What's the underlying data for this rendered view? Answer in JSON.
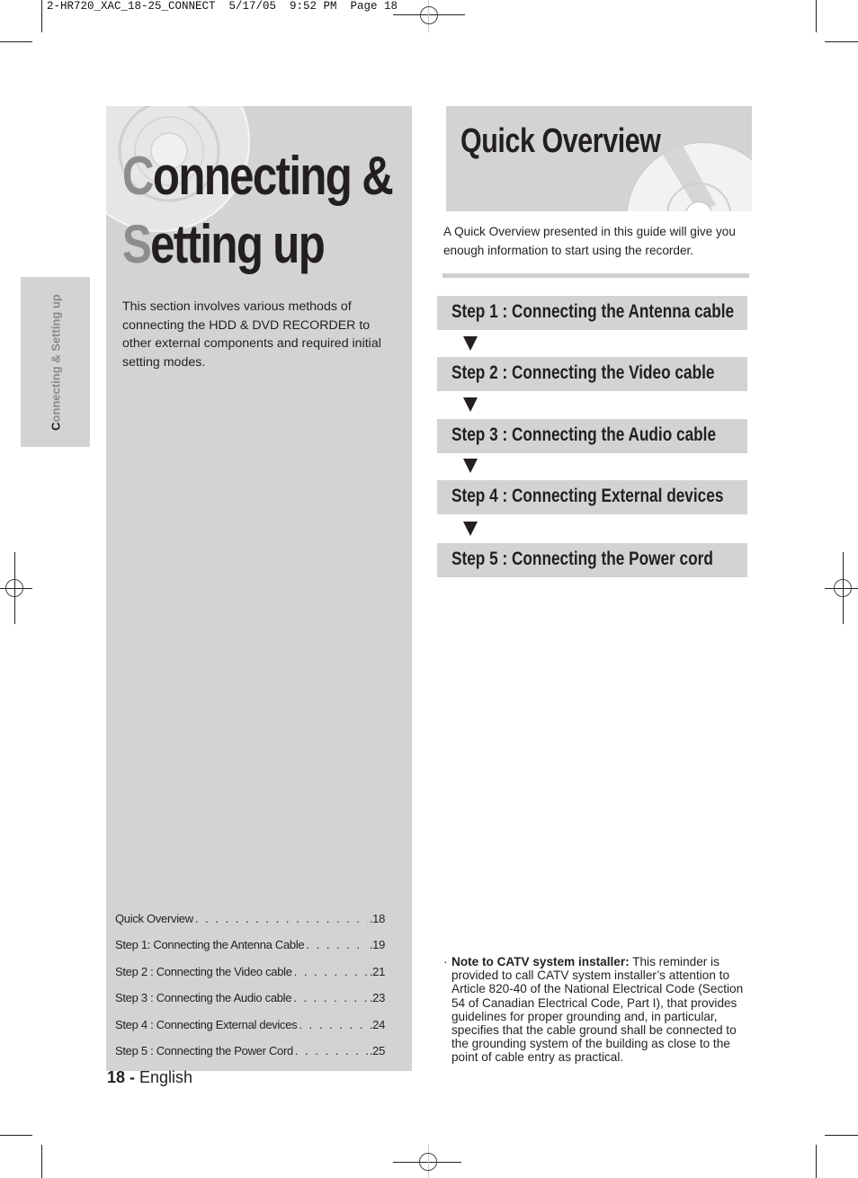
{
  "print_slug": "2-HR720_XAC_18-25_CONNECT  5/17/05  9:52 PM  Page 18",
  "side_tab": {
    "cap": "C",
    "rest": "onnecting & Setting up"
  },
  "chapter": {
    "title_line1_cap": "C",
    "title_line1_rest": "onnecting &",
    "title_line2_cap": "S",
    "title_line2_rest": "etting up",
    "intro": "This section involves various methods of connecting the HDD & DVD RECORDER to other external components and required initial setting modes."
  },
  "toc": [
    {
      "label": "Quick Overview",
      "page": ".18"
    },
    {
      "label": "Step 1: Connecting the Antenna Cable",
      "page": ".19"
    },
    {
      "label": "Step 2 : Connecting the Video cable",
      "page": ".21"
    },
    {
      "label": "Step 3 : Connecting the Audio cable",
      "page": ".23"
    },
    {
      "label": "Step 4 : Connecting External devices",
      "page": ".24"
    },
    {
      "label": "Step 5 : Connecting the Power Cord",
      "page": ".25"
    }
  ],
  "footer": {
    "page_number": "18 -",
    "language": " English"
  },
  "quick_overview": {
    "title": "Quick Overview",
    "description": "A Quick Overview presented in this guide will give you enough information to start using the recorder.",
    "steps": [
      "Step 1 : Connecting the Antenna cable",
      "Step 2 : Connecting the Video cable",
      "Step 3 : Connecting the Audio cable",
      "Step 4 : Connecting External devices",
      "Step 5 : Connecting the Power cord"
    ],
    "arrow_icon": "down-triangle-icon"
  },
  "note": {
    "bullet": "·",
    "heading": "Note to CATV system installer:",
    "text": " This reminder is provided to call CATV system installer’s attention to Article 820-40 of the National Electrical Code (Section 54 of Canadian Electrical Code, Part I), that provides guidelines for proper grounding and, in particular, specifies that the cable ground shall be connected to the grounding system of the building as close to the point of cable entry as practical."
  }
}
